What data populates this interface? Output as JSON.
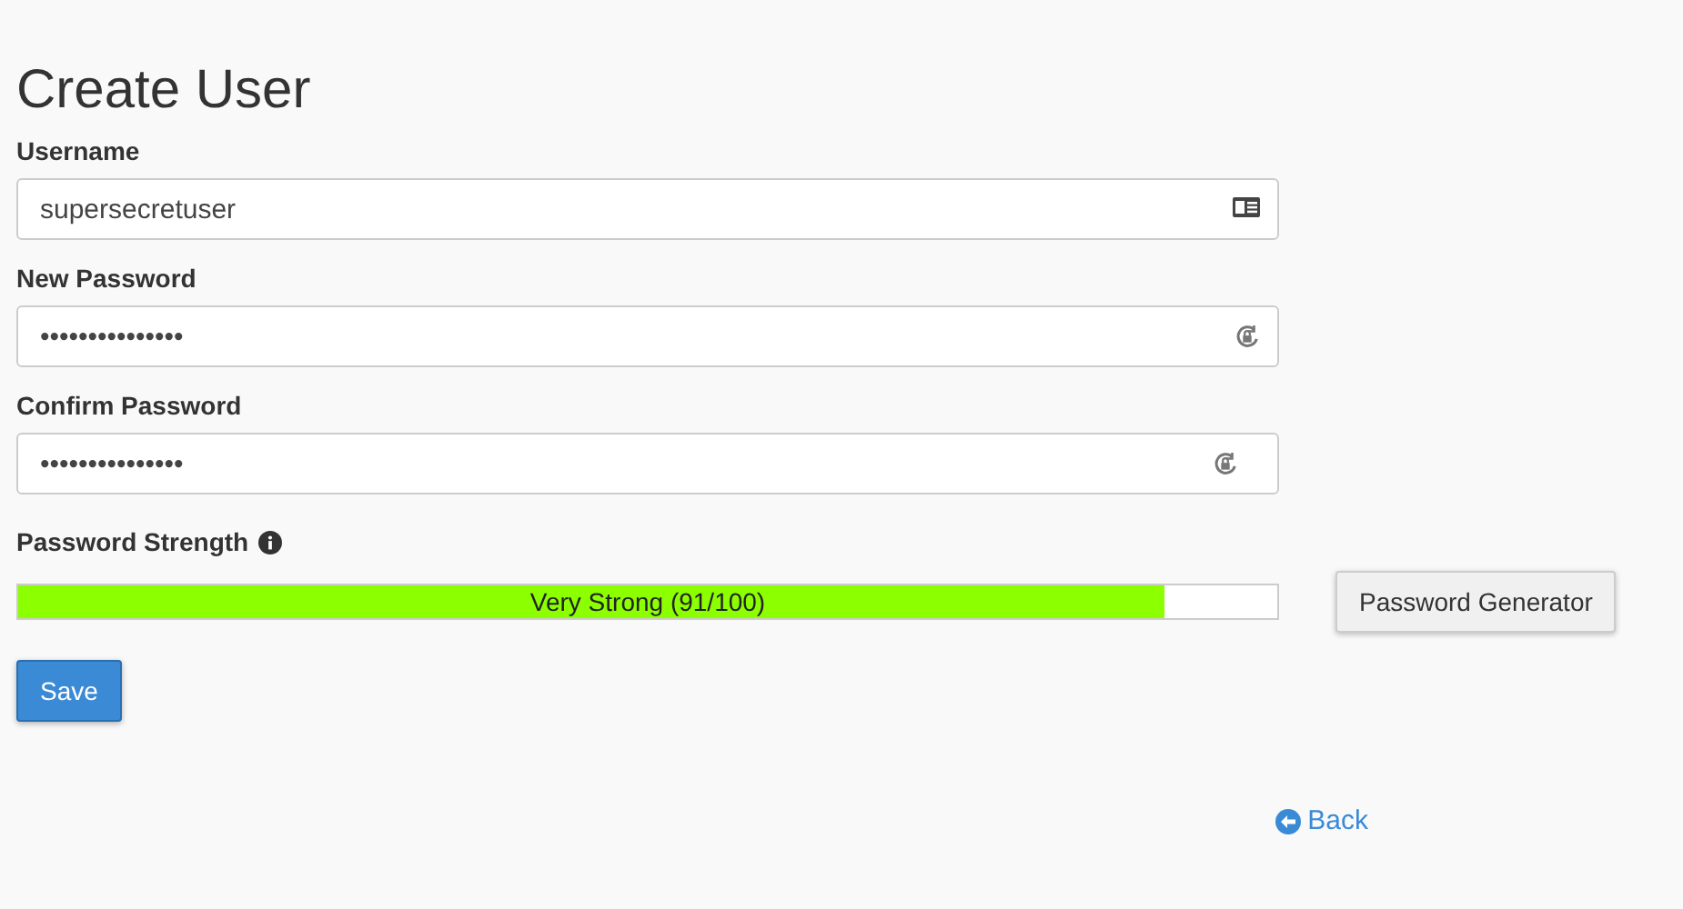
{
  "title": "Create User",
  "fields": [
    {
      "label": "Username",
      "value": "supersecretuser",
      "kind": "user"
    },
    {
      "label": "New Password",
      "value": "•••••••••••••••",
      "kind": "password"
    },
    {
      "label": "Confirm Password",
      "value": "•••••••••••••••",
      "kind": "password"
    }
  ],
  "strength": {
    "label": "Password Strength",
    "level": 0.91,
    "reading": "Very Strong (91/100)"
  },
  "generator_button": "Password Generator",
  "save_button": "Save",
  "back_link": "Back"
}
